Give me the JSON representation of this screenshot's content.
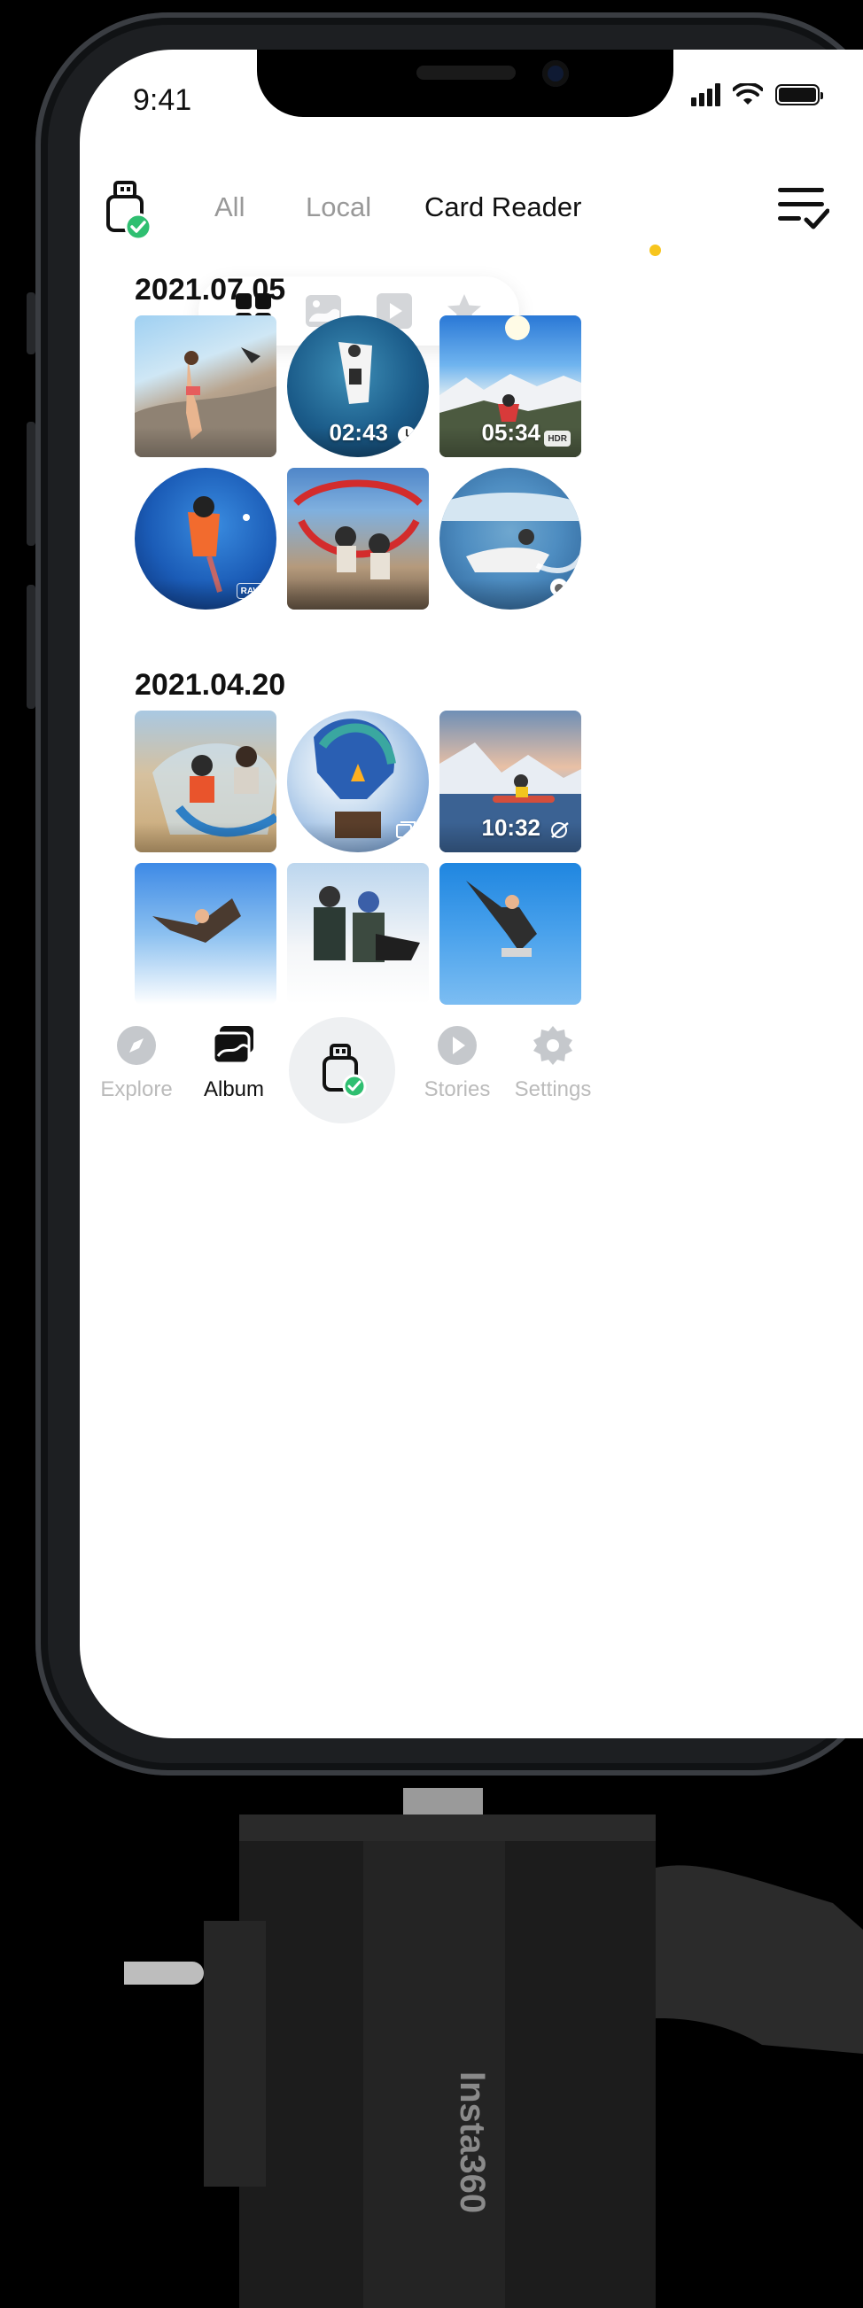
{
  "status_bar": {
    "time": "9:41"
  },
  "header": {
    "tabs": [
      {
        "label": "All",
        "active": false
      },
      {
        "label": "Local",
        "active": false
      },
      {
        "label": "Card Reader",
        "active": true
      }
    ],
    "accent": "#f7c51d"
  },
  "filters": [
    "grid-icon",
    "photo-icon",
    "video-icon",
    "star-icon"
  ],
  "sections": [
    {
      "date": "2021.07.05",
      "items": [
        {
          "kind": "photo",
          "badge": ""
        },
        {
          "kind": "video-360",
          "duration": "02:43",
          "badge": "clock"
        },
        {
          "kind": "video",
          "duration": "05:34",
          "badge": "HDR"
        },
        {
          "kind": "photo-360",
          "badge": "RAW"
        },
        {
          "kind": "photo",
          "badge": ""
        },
        {
          "kind": "photo-360",
          "badge": "planet"
        }
      ]
    },
    {
      "date": "2021.04.20",
      "items": [
        {
          "kind": "photo",
          "badge": ""
        },
        {
          "kind": "photo-360",
          "badge": "burst"
        },
        {
          "kind": "video",
          "duration": "10:32",
          "badge": "flowstate"
        },
        {
          "kind": "photo",
          "badge": ""
        },
        {
          "kind": "photo",
          "badge": ""
        },
        {
          "kind": "photo",
          "badge": ""
        }
      ]
    }
  ],
  "bottom_nav": {
    "explore": "Explore",
    "album": "Album",
    "stories": "Stories",
    "settings": "Settings"
  },
  "device": {
    "brand": "Insta360"
  }
}
